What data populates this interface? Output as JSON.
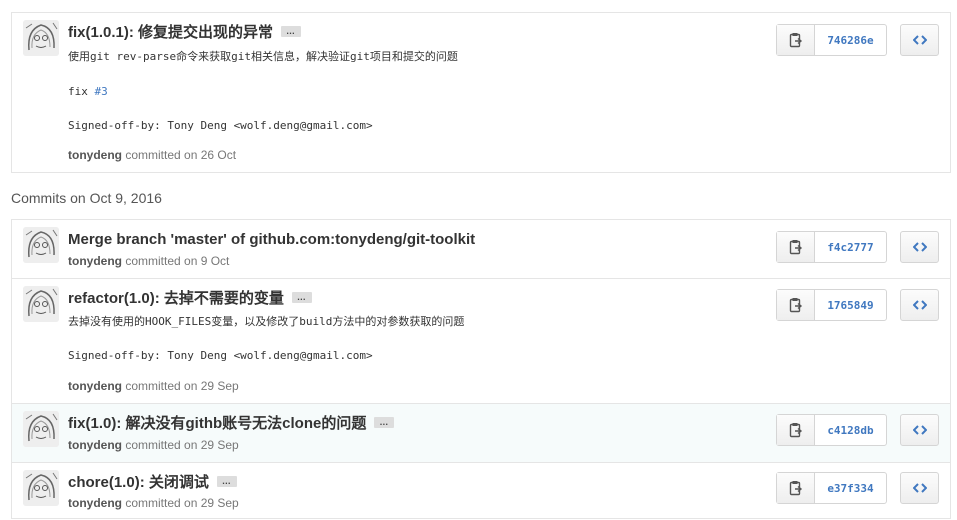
{
  "commit_groups": [
    {
      "commits": [
        {
          "title": "fix(1.0.1): 修复提交出现的异常",
          "description_line1": "使用git rev-parse命令来获取git相关信息，解决验证git项目和提交的问题",
          "fix_prefix": "fix ",
          "issue_link": "#3",
          "signed_off": "Signed-off-by: Tony Deng <wolf.deng@gmail.com>",
          "author": "tonydeng",
          "committed_text": " committed on 26 Oct",
          "sha": "746286e"
        }
      ]
    },
    {
      "heading": "Commits on Oct 9, 2016",
      "commits": [
        {
          "title": "Merge branch 'master' of github.com:tonydeng/git-toolkit",
          "author": "tonydeng",
          "committed_text": " committed on 9 Oct",
          "sha": "f4c2777"
        },
        {
          "title": "refactor(1.0): 去掉不需要的变量",
          "description_line1": "去掉没有使用的HOOK_FILES变量，以及修改了build方法中的对参数获取的问题",
          "signed_off": "Signed-off-by: Tony Deng <wolf.deng@gmail.com>",
          "author": "tonydeng",
          "committed_text": " committed on 29 Sep",
          "sha": "1765849"
        },
        {
          "title": "fix(1.0): 解决没有githb账号无法clone的问题",
          "author": "tonydeng",
          "committed_text": " committed on 29 Sep",
          "sha": "c4128db"
        },
        {
          "title": "chore(1.0): 关闭调试",
          "author": "tonydeng",
          "committed_text": " committed on 29 Sep",
          "sha": "e37f334"
        }
      ]
    }
  ],
  "ellipsis_label": "…",
  "icons": {
    "copy": "clipboard-icon",
    "browse": "code-icon"
  },
  "colors": {
    "link": "#4078c0",
    "highlight_row": "#f6fbfb"
  }
}
